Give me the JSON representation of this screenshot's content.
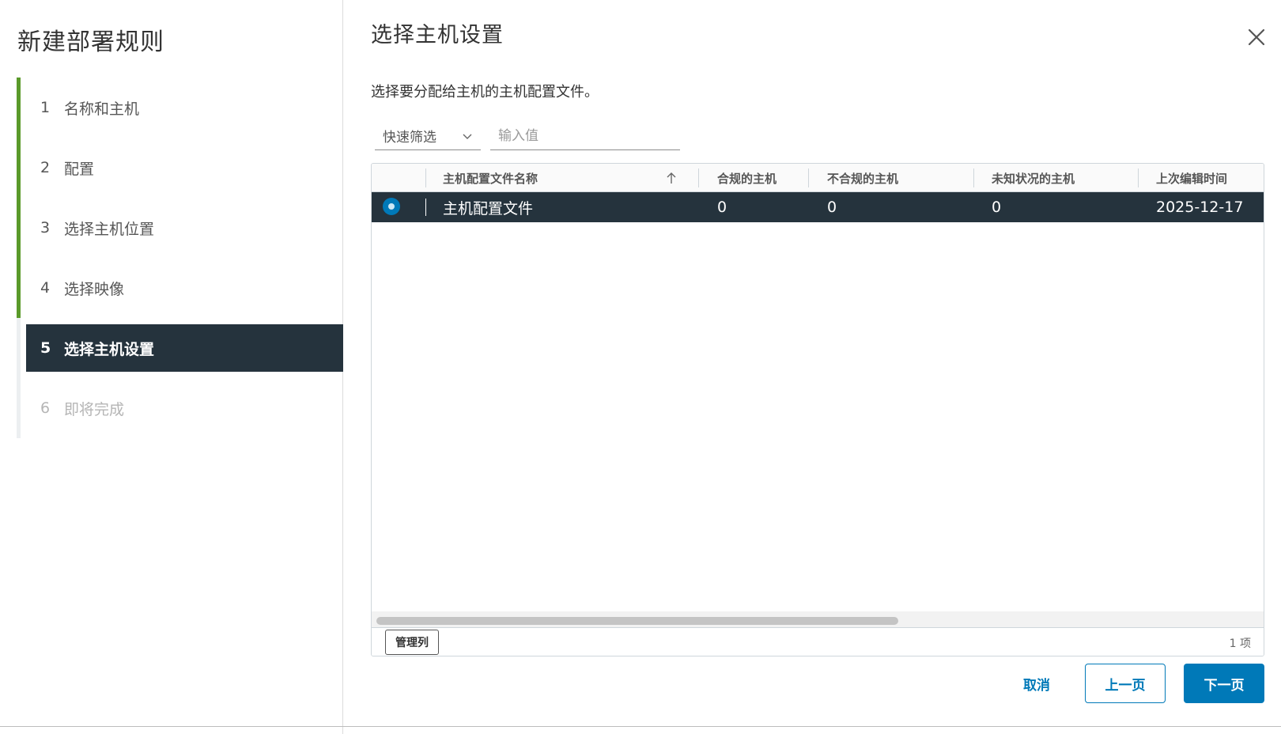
{
  "wizard": {
    "title": "新建部署规则",
    "steps": [
      {
        "num": "1",
        "label": "名称和主机"
      },
      {
        "num": "2",
        "label": "配置"
      },
      {
        "num": "3",
        "label": "选择主机位置"
      },
      {
        "num": "4",
        "label": "选择映像"
      },
      {
        "num": "5",
        "label": "选择主机设置"
      },
      {
        "num": "6",
        "label": "即将完成"
      }
    ],
    "active_step": 5
  },
  "main": {
    "title": "选择主机设置",
    "description": "选择要分配给主机的主机配置文件。",
    "filter": {
      "select_label": "快速筛选",
      "input_placeholder": "输入值"
    },
    "grid": {
      "columns": [
        "主机配置文件名称",
        "合规的主机",
        "不合规的主机",
        "未知状况的主机",
        "上次编辑时间"
      ],
      "rows": [
        {
          "selected": true,
          "name": "主机配置文件",
          "compliant": "0",
          "noncompliant": "0",
          "unknown": "0",
          "last_edited": "2025-12-17"
        }
      ],
      "manage_columns_label": "管理列",
      "item_count": "1 项"
    },
    "buttons": {
      "cancel": "取消",
      "prev": "上一页",
      "next": "下一页"
    }
  },
  "colors": {
    "accent": "#0079b8",
    "dark": "#25333d",
    "step_done": "#5a9a2a"
  }
}
